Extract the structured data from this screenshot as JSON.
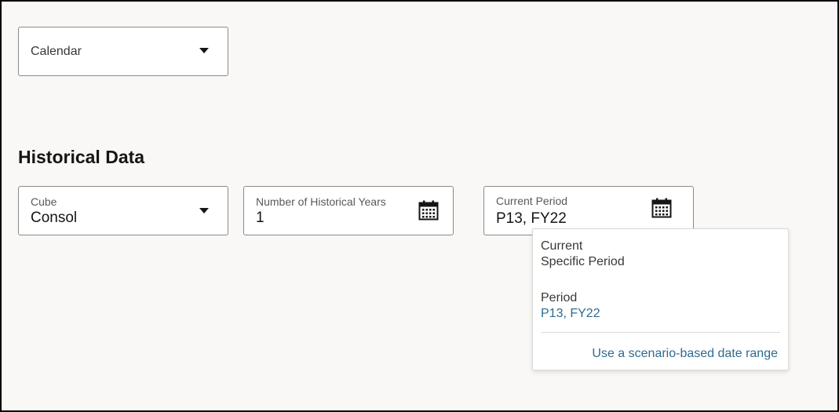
{
  "calendar_select": {
    "value": "Calendar"
  },
  "historical_data": {
    "title": "Historical Data",
    "cube": {
      "label": "Cube",
      "value": "Consol"
    },
    "historical_years": {
      "label": "Number of Historical Years",
      "value": "1"
    },
    "current_period": {
      "label": "Current Period",
      "value": "P13, FY22"
    }
  },
  "period_popup": {
    "option_current": "Current",
    "option_specific": "Specific Period",
    "period_label": "Period",
    "period_value": "P13, FY22",
    "scenario_link": "Use a scenario-based date range"
  },
  "icons": {
    "dropdown": "chevron-down-icon",
    "calendar": "calendar-icon"
  },
  "colors": {
    "background": "#f9f8f6",
    "field_border": "#8c8a86",
    "link": "#2e6b8f",
    "text": "#161513"
  }
}
